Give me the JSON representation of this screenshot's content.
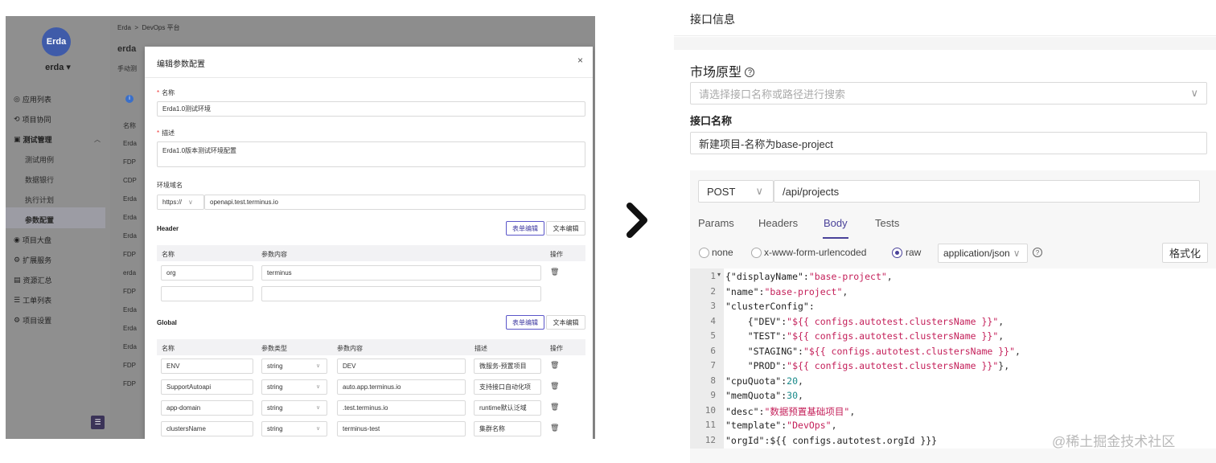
{
  "left": {
    "logo_text": "Erda",
    "org_name": "erda",
    "breadcrumb": [
      "Erda",
      ">",
      "DevOps 平台"
    ],
    "page_title": "erda",
    "sub_text": "手动测",
    "menu": [
      "应用列表",
      "项目协同",
      "测试管理",
      "测试用例",
      "数据银行",
      "执行计划",
      "参数配置",
      "项目大盘",
      "扩展服务",
      "资源汇总",
      "工单列表",
      "项目设置"
    ],
    "bg_rows": [
      "名称",
      "Erda",
      "FDP",
      "CDP",
      "Erda",
      "Erda",
      "Erda",
      "FDP",
      "erda",
      "FDP",
      "Erda",
      "Erda",
      "Erda",
      "FDP",
      "FDP"
    ],
    "modal": {
      "title": "编辑参数配置",
      "close": "×",
      "name_label": "名称",
      "name_value": "Erda1.0测试环境",
      "desc_label": "描述",
      "desc_value": "Erda1.0版本测试环境配置",
      "domain_label": "环境域名",
      "protocol": "https://",
      "domain_value": "openapi.test.terminus.io",
      "header_section": "Header",
      "form_edit": "表单编辑",
      "text_edit": "文本编辑",
      "header_cols": [
        "名称",
        "参数内容",
        "操作"
      ],
      "header_rows": [
        {
          "name": "org",
          "value": "terminus"
        }
      ],
      "global_section": "Global",
      "global_cols": [
        "名称",
        "参数类型",
        "参数内容",
        "描述",
        "操作"
      ],
      "global_rows": [
        {
          "name": "ENV",
          "type": "string",
          "value": "DEV",
          "desc": "微服务-预置项目"
        },
        {
          "name": "SupportAutoapi",
          "type": "string",
          "value": "auto.app.terminus.io",
          "desc": "支持接口自动化项"
        },
        {
          "name": "app-domain",
          "type": "string",
          "value": ".test.terminus.io",
          "desc": "runtime默认泛域"
        },
        {
          "name": "clustersName",
          "type": "string",
          "value": "terminus-test",
          "desc": "集群名称"
        }
      ]
    }
  },
  "right": {
    "header_title": "接口信息",
    "market_label": "市场原型",
    "help_icon": "?",
    "search_placeholder": "请选择接口名称或路径进行搜索",
    "api_name_label": "接口名称",
    "api_name_value": "新建项目-名称为base-project",
    "method": "POST",
    "path": "/api/projects",
    "tabs": [
      "Params",
      "Headers",
      "Body",
      "Tests"
    ],
    "active_tab": "Body",
    "body_types": [
      "none",
      "x-www-form-urlencoded",
      "raw"
    ],
    "selected_body_type": "raw",
    "content_type": "application/json",
    "format_button": "格式化",
    "code_lines": [
      "1",
      "2",
      "3",
      "4",
      "5",
      "6",
      "7",
      "8",
      "9",
      "10",
      "11",
      "12"
    ],
    "code": {
      "l1k": "{\"displayName\":",
      "l1v": "\"base-project\"",
      "l1e": ",",
      "l2k": "\"name\":",
      "l2v": "\"base-project\"",
      "l2e": ",",
      "l3k": "\"clusterConfig\":",
      "l4k": "    {\"DEV\":",
      "l4v": "\"${{ configs.autotest.clustersName }}\"",
      "l4e": ",",
      "l5k": "    \"TEST\":",
      "l5v": "\"${{ configs.autotest.clustersName }}\"",
      "l5e": ",",
      "l6k": "    \"STAGING\":",
      "l6v": "\"${{ configs.autotest.clustersName }}\"",
      "l6e": ",",
      "l7k": "    \"PROD\":",
      "l7v": "\"${{ configs.autotest.clustersName }}\"",
      "l7e": "},",
      "l8k": "\"cpuQuota\":",
      "l8v": "20",
      "l8e": ",",
      "l9k": "\"memQuota\":",
      "l9v": "30",
      "l9e": ",",
      "l10k": "\"desc\":",
      "l10v": "\"数据预置基础项目\"",
      "l10e": ",",
      "l11k": "\"template\":",
      "l11v": "\"DevOps\"",
      "l11e": ",",
      "l12k": "\"orgId\":${{ configs.autotest.orgId }}}"
    },
    "watermark": "@稀土掘金技术社区"
  },
  "colors": {
    "accent": "#4a4299",
    "string": "#c4205a",
    "number": "#1a8a8a"
  }
}
